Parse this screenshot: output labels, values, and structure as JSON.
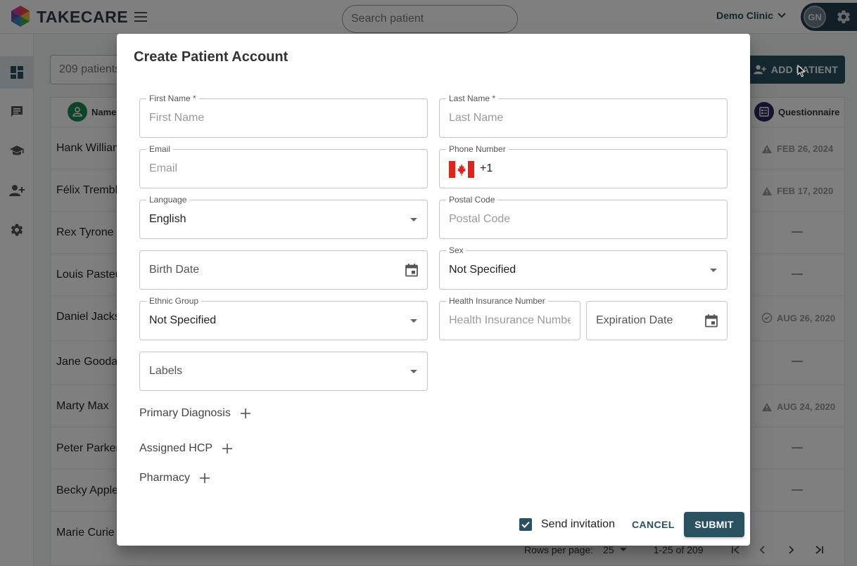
{
  "app": {
    "brand": "TAKECARE"
  },
  "topbar": {
    "search_placeholder": "Search patient",
    "clinic": "Demo Clinic",
    "user_initials": "GN"
  },
  "page": {
    "count_text": "209 patients",
    "add_patient_label": "ADD PATIENT",
    "columns": {
      "name": "Name",
      "questionnaire": "Questionnaire"
    },
    "rows": [
      {
        "name": "Hank Williams",
        "questionnaire": "FEB 26, 2024",
        "status": "warning"
      },
      {
        "name": "Félix Tremblay",
        "questionnaire": "FEB 17, 2020",
        "status": "warning"
      },
      {
        "name": "Rex Tyrone",
        "questionnaire": "—",
        "status": "none"
      },
      {
        "name": "Louis Pasteur",
        "questionnaire": "—",
        "status": "none"
      },
      {
        "name": "Daniel Jackson",
        "questionnaire": "AUG 26, 2020",
        "status": "done"
      },
      {
        "name": "Jane Goodall",
        "questionnaire": "—",
        "status": "none"
      },
      {
        "name": "Marty Max",
        "questionnaire": "AUG 24, 2020",
        "status": "warning"
      },
      {
        "name": "Peter Parker",
        "questionnaire": "—",
        "status": "none"
      },
      {
        "name": "Becky Apple",
        "questionnaire": "—",
        "status": "none"
      },
      {
        "name": "Marie Curie",
        "questionnaire": "",
        "status": "none"
      }
    ],
    "pagination": {
      "rows_per_page_label": "Rows per page:",
      "rows_per_page": "25",
      "range": "1-25 of 209"
    }
  },
  "dialog": {
    "title": "Create Patient Account",
    "fields": {
      "first_name": {
        "label": "First Name *",
        "placeholder": "First Name"
      },
      "last_name": {
        "label": "Last Name *",
        "placeholder": "Last Name"
      },
      "email": {
        "label": "Email",
        "placeholder": "Email"
      },
      "phone": {
        "label": "Phone Number",
        "dial_code": "+1"
      },
      "language": {
        "label": "Language",
        "value": "English"
      },
      "postal_code": {
        "label": "Postal Code",
        "placeholder": "Postal Code"
      },
      "birth_date": {
        "placeholder": "Birth Date"
      },
      "sex": {
        "label": "Sex",
        "value": "Not Specified"
      },
      "ethnic_group": {
        "label": "Ethnic Group",
        "value": "Not Specified"
      },
      "health_insurance": {
        "label": "Health Insurance Number",
        "placeholder": "Health Insurance Number"
      },
      "expiration_date": {
        "placeholder": "Expiration Date"
      },
      "labels": {
        "placeholder": "Labels"
      }
    },
    "sections": {
      "primary_diagnosis": "Primary Diagnosis",
      "assigned_hcp": "Assigned HCP",
      "pharmacy": "Pharmacy"
    },
    "send_invitation": {
      "label": "Send invitation",
      "checked": true
    },
    "cancel_label": "CANCEL",
    "submit_label": "SUBMIT"
  },
  "colors": {
    "primary": "#2a5160",
    "topbar_pill": "#243d4a",
    "warning": "#f2a33a"
  }
}
